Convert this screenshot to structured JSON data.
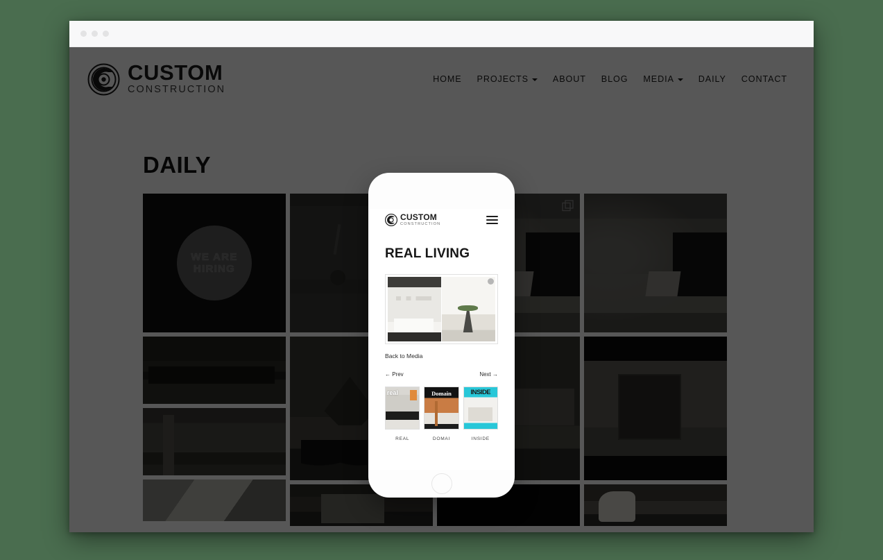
{
  "browser": {
    "dots": [
      "dot-1",
      "dot-2",
      "dot-3"
    ]
  },
  "site": {
    "brand": {
      "title": "CUSTOM",
      "subtitle": "CONSTRUCTION",
      "logo_icon": "spiral-c-logo-icon"
    },
    "nav": [
      {
        "label": "HOME",
        "has_dropdown": false
      },
      {
        "label": "PROJECTS",
        "has_dropdown": true
      },
      {
        "label": "ABOUT",
        "has_dropdown": false
      },
      {
        "label": "BLOG",
        "has_dropdown": false
      },
      {
        "label": "MEDIA",
        "has_dropdown": true
      },
      {
        "label": "DAILY",
        "has_dropdown": false
      },
      {
        "label": "CONTACT",
        "has_dropdown": false
      }
    ],
    "page_title": "DAILY",
    "gallery": {
      "multi_image_icon": "layers-icon",
      "tiles": [
        {
          "name": "we-are-hiring",
          "alt_text": "WE ARE HIRING",
          "overlay_text_line1": "WE ARE",
          "overlay_text_line2": "HIRING"
        },
        {
          "name": "dark-kitchen-detail",
          "alt_text": "Dark kitchen pendant detail"
        },
        {
          "name": "interior-white-room",
          "alt_text": "White interior room"
        },
        {
          "name": "living-room-sunlight",
          "alt_text": "Living room with sunlight"
        },
        {
          "name": "house-exterior-night",
          "alt_text": "House exterior at dusk"
        },
        {
          "name": "white-weatherboard-house",
          "alt_text": "White weatherboard house"
        },
        {
          "name": "kitchen-with-stools",
          "alt_text": "Kitchen bench with black stools"
        },
        {
          "name": "house-with-tree",
          "alt_text": "House behind large tree"
        },
        {
          "name": "butlers-pantry",
          "alt_text": "Butlers pantry with glass cabinets"
        },
        {
          "name": "corridor-light",
          "alt_text": "Bright corridor"
        },
        {
          "name": "workshop-plans",
          "alt_text": "Workshop with plans"
        },
        {
          "name": "dark-frame",
          "alt_text": "Dark frame"
        },
        {
          "name": "stable-interior",
          "alt_text": "Stable interior"
        }
      ]
    }
  },
  "lightbox": {
    "phone": {
      "brand": {
        "title": "CUSTOM",
        "subtitle": "CONSTRUCTION",
        "logo_icon": "spiral-c-logo-icon"
      },
      "menu_icon": "hamburger-menu-icon",
      "title": "REAL LIVING",
      "feature": {
        "alt_text": "Real Living magazine spread, kitchen feature",
        "badge_icon": "dot-badge-icon"
      },
      "back_link": "Back to Media",
      "prev_label": "← Prev",
      "next_label": "Next →",
      "thumbnails": [
        {
          "name": "thumb-real-living",
          "caption": "REAL",
          "cover": "real living magazine cover"
        },
        {
          "name": "thumb-domain",
          "caption": "DOMAI",
          "cover": "Domain magazine cover"
        },
        {
          "name": "thumb-inside-out",
          "caption": "INSIDE",
          "cover": "Inside Out magazine cover"
        }
      ],
      "home_button_icon": "home-button-icon"
    }
  },
  "colors": {
    "page_background": "#4a6d4f",
    "overlay": "rgba(0,0,0,0.66)",
    "dimmed_white": "#575757",
    "accent_inside": "#28c7d8",
    "accent_domain": "#c97c44"
  }
}
